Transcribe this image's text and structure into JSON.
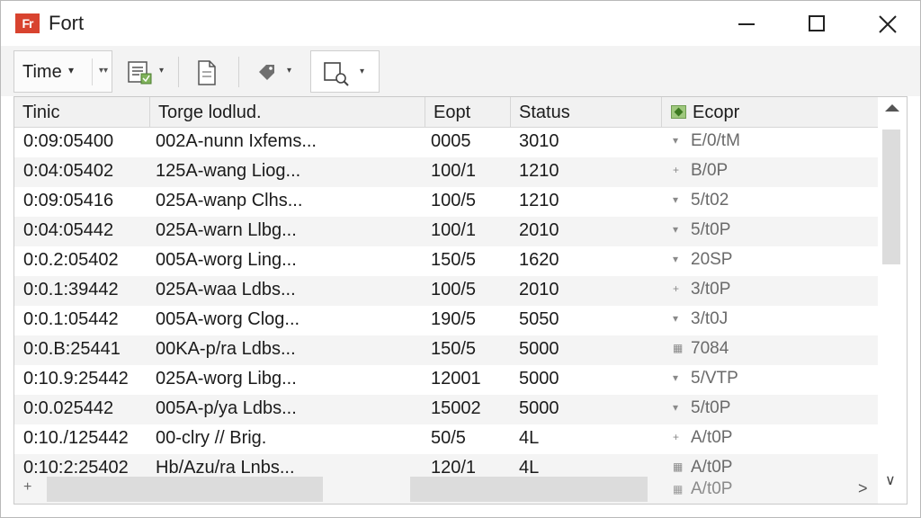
{
  "window": {
    "app_icon": "Fr",
    "title": "Fort",
    "controls": {
      "minimize": "minimize-icon",
      "maximize": "maximize-icon",
      "close": "close-icon"
    }
  },
  "toolbar": {
    "time_label": "Time",
    "time_caret": "▾",
    "time_caret2": "▾▾",
    "caret": "▾"
  },
  "table": {
    "columns": [
      "Tinic",
      "Torge lodlud.",
      "Eopt",
      "Status",
      "Ecopr"
    ],
    "rows": [
      {
        "time": "0:09:05400",
        "name": "002A-nunn Ixfems...",
        "eopt": "0005",
        "status": "3010",
        "mark": "▾",
        "ecopr": "E/0/tM"
      },
      {
        "time": "0:04:05402",
        "name": "125A-wang Liog...",
        "eopt": "100/1",
        "status": "1210",
        "mark": "+",
        "ecopr": "B/0P"
      },
      {
        "time": "0:09:05416",
        "name": "025A-wanp Clhs...",
        "eopt": "100/5",
        "status": "1210",
        "mark": "▾",
        "ecopr": "5/t02"
      },
      {
        "time": "0:04:05442",
        "name": "025A-warn Llbg...",
        "eopt": "100/1",
        "status": "2010",
        "mark": "▾",
        "ecopr": "5/t0P"
      },
      {
        "time": "0:0.2:05402",
        "name": "005A-worg Ling...",
        "eopt": "150/5",
        "status": "1620",
        "mark": "▾",
        "ecopr": "20SP"
      },
      {
        "time": "0:0.1:39442",
        "name": "025A-waa Ldbs...",
        "eopt": "100/5",
        "status": "2010",
        "mark": "+",
        "ecopr": "3/t0P"
      },
      {
        "time": "0:0.1:05442",
        "name": "005A-worg Clog...",
        "eopt": "190/5",
        "status": "5050",
        "mark": "▾",
        "ecopr": "3/t0J"
      },
      {
        "time": "0:0.B:25441",
        "name": "00KA-p/ra Ldbs...",
        "eopt": "150/5",
        "status": "5000",
        "mark": "▦",
        "ecopr": "7084"
      },
      {
        "time": "0:10.9:25442",
        "name": "025A-worg Libg...",
        "eopt": "12001",
        "status": "5000",
        "mark": "▾",
        "ecopr": "5/VTP"
      },
      {
        "time": "0:0.025442",
        "name": "005A-p/ya Ldbs...",
        "eopt": "15002",
        "status": "5000",
        "mark": "▾",
        "ecopr": "5/t0P"
      },
      {
        "time": "0:10./125442",
        "name": "00-clry // Brig.",
        "eopt": "50/5",
        "status": "4L",
        "mark": "+",
        "ecopr": "A/t0P"
      },
      {
        "time": "0:10:2:25402",
        "name": "Hb/Azu/ra Lnbs...",
        "eopt": "120/1",
        "status": "4L",
        "mark": "▦",
        "ecopr": "A/t0P"
      }
    ],
    "footer_partial": {
      "mark": "▦",
      "ecopr": "A/t0P"
    }
  },
  "scroll": {
    "up": "▲",
    "down": "∨",
    "left": "+",
    "right": ">"
  },
  "colors": {
    "app_icon": "#d8432f",
    "header_bg": "#f1f1f1",
    "alt_row": "#f4f4f4",
    "scroll_thumb": "#dcdcdc"
  }
}
